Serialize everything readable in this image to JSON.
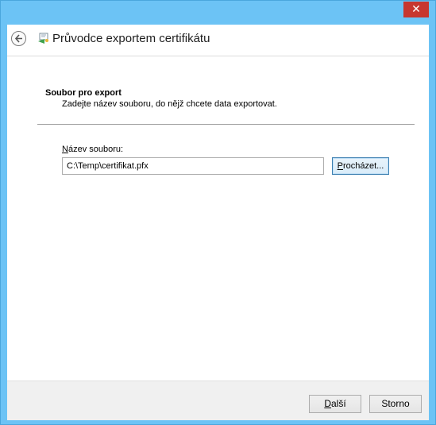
{
  "window": {
    "title": "Průvodce exportem certifikátu",
    "close_glyph": "✕"
  },
  "section": {
    "title": "Soubor pro export",
    "description": "Zadejte název souboru, do nějž chcete data exportovat."
  },
  "file": {
    "label_accel": "N",
    "label_rest": "ázev souboru:",
    "value": "C:\\Temp\\certifikat.pfx"
  },
  "buttons": {
    "browse_accel": "P",
    "browse_rest": "rocházet...",
    "next_accel": "D",
    "next_rest": "alší",
    "cancel": "Storno"
  },
  "icons": {
    "back": "back-arrow-icon",
    "certificate": "certificate-wizard-icon",
    "close": "close-icon"
  },
  "colors": {
    "frame": "#6cc3f5",
    "close": "#c7372f",
    "accent": "#3c7fb1"
  }
}
